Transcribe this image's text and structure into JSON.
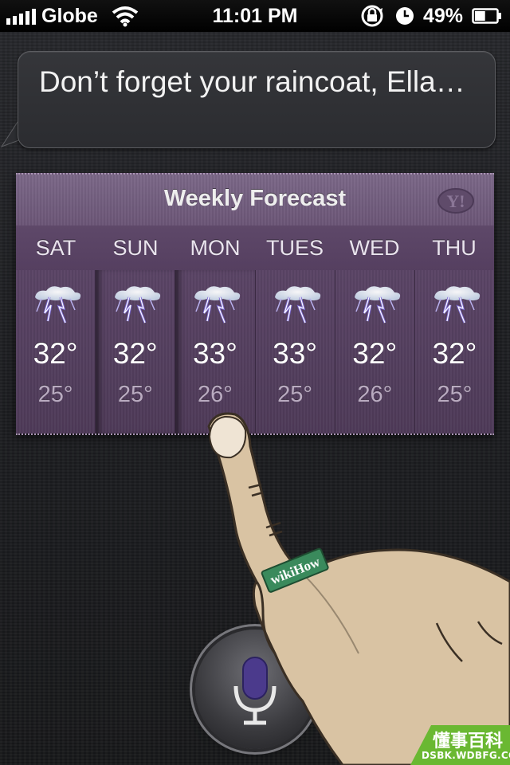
{
  "status_bar": {
    "carrier": "Globe",
    "time": "11:01 PM",
    "battery_percent": "49%",
    "battery_level": 0.49,
    "signal_bars": 5,
    "icons": [
      "signal-bars-icon",
      "wifi-icon",
      "rotation-lock-icon",
      "alarm-clock-icon",
      "battery-icon"
    ]
  },
  "siri": {
    "response_text": "Don’t forget your raincoat, Ella…"
  },
  "forecast": {
    "title": "Weekly Forecast",
    "provider_logo": "Y!",
    "days": [
      {
        "day": "SAT",
        "high": "32°",
        "low": "25°",
        "icon": "thunderstorm-icon"
      },
      {
        "day": "SUN",
        "high": "32°",
        "low": "25°",
        "icon": "thunderstorm-icon"
      },
      {
        "day": "MON",
        "high": "33°",
        "low": "26°",
        "icon": "thunderstorm-icon"
      },
      {
        "day": "TUES",
        "high": "33°",
        "low": "25°",
        "icon": "thunderstorm-icon"
      },
      {
        "day": "WED",
        "high": "32°",
        "low": "26°",
        "icon": "thunderstorm-icon"
      },
      {
        "day": "THU",
        "high": "32°",
        "low": "25°",
        "icon": "thunderstorm-icon"
      }
    ]
  },
  "illustration": {
    "ring_text": "wikiHow"
  },
  "mic_button": {
    "icon": "microphone-icon"
  },
  "watermark": {
    "chinese": "懂事百科",
    "url": "DSBK.WDBFG.COM"
  },
  "colors": {
    "card_purple": "#5a4466",
    "header_purple": "#74607f",
    "mic_purple": "#4b3a8c",
    "watermark_green": "#6ab832",
    "ring_green": "#3a8a5c",
    "skin": "#d9c3a3"
  }
}
